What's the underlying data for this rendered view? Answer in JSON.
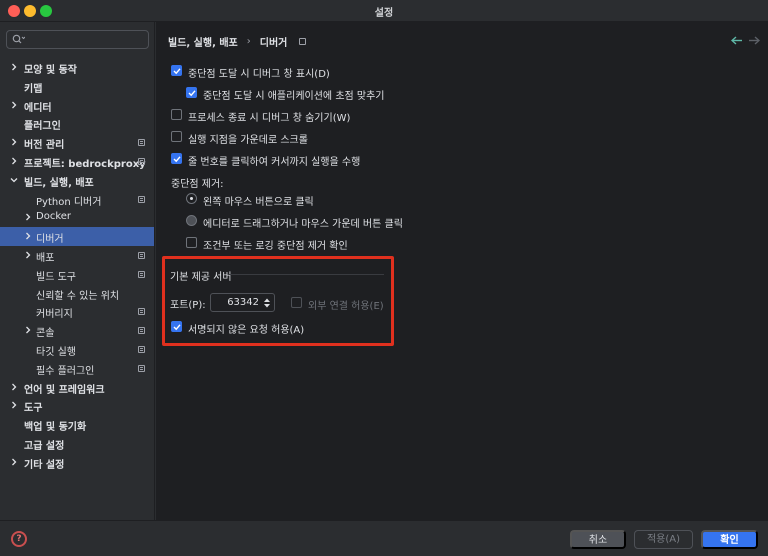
{
  "window": {
    "title": "설정"
  },
  "search": {
    "value": "",
    "placeholder": ""
  },
  "sidebar": {
    "items": [
      {
        "label": "모양 및 동작",
        "bold": true,
        "chevron": true,
        "indent": 0
      },
      {
        "label": "키맵",
        "bold": true,
        "chevron": false,
        "indent": 0
      },
      {
        "label": "에디터",
        "bold": true,
        "chevron": true,
        "indent": 0
      },
      {
        "label": "플러그인",
        "bold": true,
        "chevron": false,
        "indent": 0
      },
      {
        "label": "버전 관리",
        "bold": true,
        "chevron": true,
        "indent": 0,
        "badge": true
      },
      {
        "label": "프로젝트: bedrockproxy",
        "bold": true,
        "chevron": true,
        "indent": 0,
        "badge": true
      },
      {
        "label": "빌드, 실행, 배포",
        "bold": true,
        "chevron": "expanded",
        "indent": 0
      },
      {
        "label": "Python 디버거",
        "bold": false,
        "chevron": false,
        "indent": 2,
        "badge": true
      },
      {
        "label": "Docker",
        "bold": false,
        "chevron": true,
        "indent": 1
      },
      {
        "label": "디버거",
        "bold": false,
        "chevron": true,
        "indent": 1,
        "selected": true
      },
      {
        "label": "배포",
        "bold": false,
        "chevron": true,
        "indent": 1,
        "badge": true
      },
      {
        "label": "빌드 도구",
        "bold": false,
        "chevron": false,
        "indent": 2,
        "badge": true
      },
      {
        "label": "신뢰할 수 있는 위치",
        "bold": false,
        "chevron": false,
        "indent": 2
      },
      {
        "label": "커버리지",
        "bold": false,
        "chevron": false,
        "indent": 2,
        "badge": true
      },
      {
        "label": "콘솔",
        "bold": false,
        "chevron": true,
        "indent": 1,
        "badge": true
      },
      {
        "label": "타깃 실행",
        "bold": false,
        "chevron": false,
        "indent": 2,
        "badge": true
      },
      {
        "label": "필수 플러그인",
        "bold": false,
        "chevron": false,
        "indent": 2,
        "badge": true
      },
      {
        "label": "언어 및 프레임워크",
        "bold": true,
        "chevron": true,
        "indent": 0
      },
      {
        "label": "도구",
        "bold": true,
        "chevron": true,
        "indent": 0
      },
      {
        "label": "백업 및 동기화",
        "bold": true,
        "chevron": false,
        "indent": 0
      },
      {
        "label": "고급 설정",
        "bold": true,
        "chevron": false,
        "indent": 0
      },
      {
        "label": "기타 설정",
        "bold": true,
        "chevron": true,
        "indent": 0
      }
    ]
  },
  "breadcrumb": {
    "parent": "빌드, 실행, 배포",
    "separator": "›",
    "current": "디버거"
  },
  "options": {
    "activate_on_breakpoint": {
      "label": "중단점 도달 시 디버그 창 표시(D)",
      "checked": true
    },
    "focus_app": {
      "label": "중단점 도달 시 애플리케이션에 초점 맞추기",
      "checked": true
    },
    "hide_on_exit": {
      "label": "프로세스 종료 시 디버그 창 숨기기(W)",
      "checked": false
    },
    "scroll_center": {
      "label": "실행 지점을 가운데로 스크롤",
      "checked": false
    },
    "run_to_cursor": {
      "label": "줄 번호를 클릭하여 커서까지 실행을 수행",
      "checked": true
    }
  },
  "remove_breakpoint": {
    "title": "중단점 제거:",
    "radio_left_click": {
      "label": "왼쪽 마우스 버튼으로 클릭",
      "checked": true
    },
    "radio_drag": {
      "label": "에디터로 드래그하거나 마우스 가운데 버튼 클릭",
      "checked": false
    },
    "confirm": {
      "label": "조건부 또는 로깅 중단점 제거 확인",
      "checked": false
    }
  },
  "builtin_server": {
    "title": "기본 제공 서버",
    "port_label": "포트(P):",
    "port_value": "63342",
    "external": {
      "label": "외부 연결 허용(E)",
      "checked": false
    },
    "unsigned": {
      "label": "서명되지 않은 요청 허용(A)",
      "checked": true
    }
  },
  "footer": {
    "help": "?",
    "cancel": "취소",
    "apply": "적용(A)",
    "ok": "확인"
  },
  "colors": {
    "accent": "#3574f0",
    "highlight_box": "#e0301e",
    "selected_row": "#3c5fa8"
  }
}
